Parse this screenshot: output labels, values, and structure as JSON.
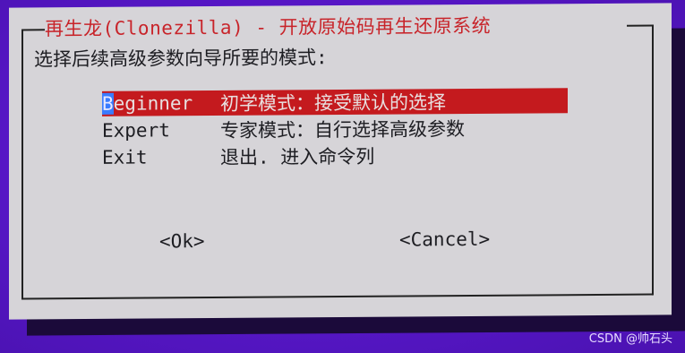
{
  "dialog": {
    "title": "再生龙(Clonezilla) - 开放原始码再生还原系统",
    "prompt": "选择后续高级参数向导所要的模式:",
    "menu": [
      {
        "key_first": "B",
        "key_rest": "eginner",
        "description": "初学模式：接受默认的选择",
        "selected": true
      },
      {
        "key": "Expert",
        "description": "专家模式：自行选择高级参数",
        "selected": false
      },
      {
        "key": "Exit",
        "description": "退出. 进入命令列",
        "selected": false
      }
    ],
    "ok_button": "<Ok>",
    "cancel_button": "<Cancel>"
  },
  "colors": {
    "screen_background": "#5a18c8",
    "dialog_background": "#d6d4d8",
    "title_text": "#c8242a",
    "selection_background": "#c41a1e",
    "cursor": "#3a7cff"
  },
  "watermark": "CSDN @帅石头"
}
